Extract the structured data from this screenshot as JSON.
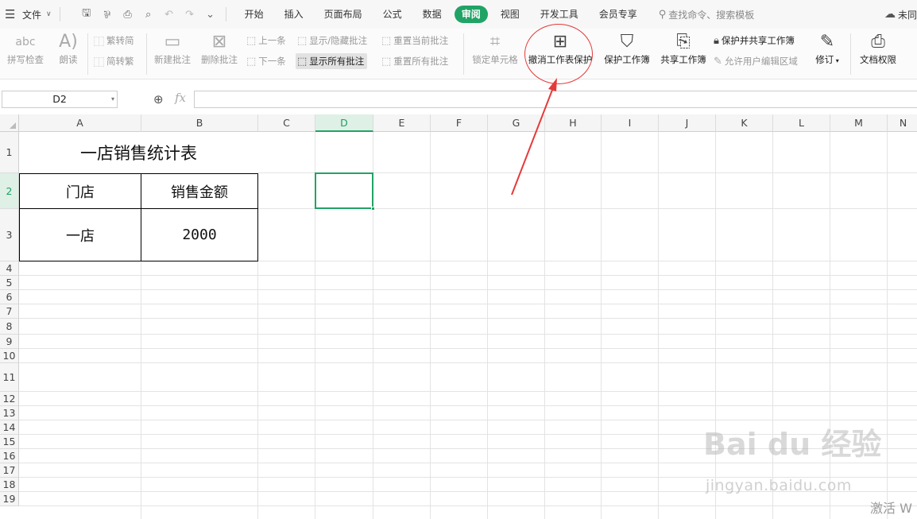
{
  "menubar": {
    "file_label": "文件",
    "tabs": [
      "开始",
      "插入",
      "页面布局",
      "公式",
      "数据",
      "审阅",
      "视图",
      "开发工具",
      "会员专享"
    ],
    "active_tab": "审阅",
    "search_placeholder": "查找命令、搜索模板",
    "cloud_label": "未同"
  },
  "ribbon": {
    "spell_check": "拼写检查",
    "read_aloud": "朗读",
    "trad_to_simp": "繁转简",
    "simp_to_trad": "简转繁",
    "new_comment": "新建批注",
    "delete_comment": "删除批注",
    "prev_comment": "上一条",
    "next_comment": "下一条",
    "show_hide_comment": "显示/隐藏批注",
    "show_all_comments": "显示所有批注",
    "reset_current_comment": "重置当前批注",
    "reset_all_comments": "重置所有批注",
    "lock_cell": "锁定单元格",
    "unprotect_sheet": "撤消工作表保护",
    "protect_sheet": "保护工作簿",
    "share_workbook": "共享工作簿",
    "protect_share_workbook": "保护并共享工作簿",
    "allow_edit_ranges": "允许用户编辑区域",
    "track_changes": "修订",
    "doc_permissions": "文档权限"
  },
  "formula_bar": {
    "name_box": "D2",
    "fx": "fx",
    "formula": ""
  },
  "sheet": {
    "columns": [
      "A",
      "B",
      "C",
      "D",
      "E",
      "F",
      "G",
      "H",
      "I",
      "J",
      "K",
      "L",
      "M",
      "N"
    ],
    "rows": [
      "1",
      "2",
      "3",
      "4",
      "5",
      "6",
      "7",
      "8",
      "9",
      "10",
      "11",
      "12",
      "13",
      "14",
      "15",
      "16",
      "17",
      "18",
      "19"
    ],
    "selected_col": "D",
    "selected_row": "2",
    "title": "一店销售统计表",
    "headers": [
      "门店",
      "销售金额"
    ],
    "data_row": [
      "一店",
      "2000"
    ]
  },
  "watermark": {
    "logo_text": "Bai du 经验",
    "url": "jingyan.baidu.com",
    "activate": "激活 W"
  },
  "colors": {
    "accent": "#21a366",
    "annotation": "#e53a3a"
  }
}
